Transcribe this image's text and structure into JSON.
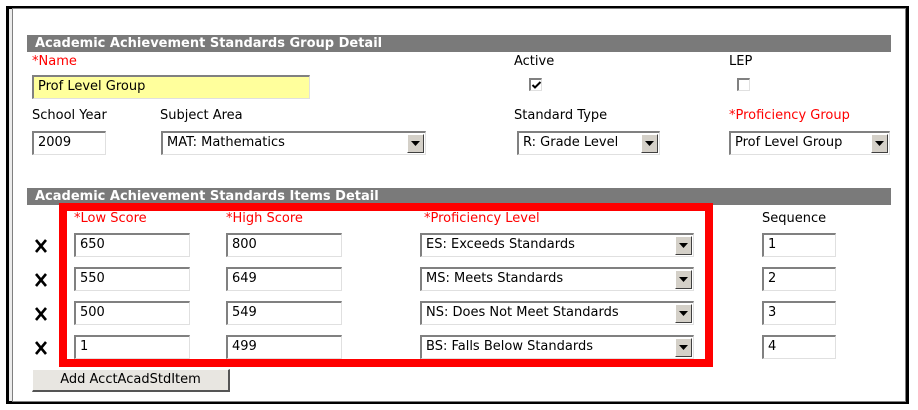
{
  "group_detail": {
    "header": "Academic Achievement Standards Group Detail",
    "name_label": "*Name",
    "name_value": "Prof Level Group",
    "active_label": "Active",
    "active_checked": true,
    "lep_label": "LEP",
    "lep_checked": false,
    "school_year_label": "School Year",
    "school_year_value": "2009",
    "subject_area_label": "Subject Area",
    "subject_area_value": "MAT: Mathematics",
    "standard_type_label": "Standard Type",
    "standard_type_value": "R: Grade Level",
    "proficiency_group_label": "*Proficiency Group",
    "proficiency_group_value": "Prof Level Group"
  },
  "items_detail": {
    "header": "Academic Achievement Standards Items Detail",
    "columns": {
      "low_score": "*Low Score",
      "high_score": "*High Score",
      "proficiency_level": "*Proficiency Level",
      "sequence": "Sequence"
    },
    "rows": [
      {
        "low": "650",
        "high": "800",
        "level": "ES: Exceeds Standards",
        "seq": "1"
      },
      {
        "low": "550",
        "high": "649",
        "level": "MS: Meets Standards",
        "seq": "2"
      },
      {
        "low": "500",
        "high": "549",
        "level": "NS: Does Not Meet Standards",
        "seq": "3"
      },
      {
        "low": "1",
        "high": "499",
        "level": "BS: Falls Below Standards",
        "seq": "4"
      }
    ],
    "add_button": "Add AcctAcadStdItem"
  },
  "colors": {
    "required": "#ff0000",
    "header_bg": "#7a7a7a",
    "highlight_box": "#ff0000",
    "name_field_bg": "#ffff9c"
  },
  "icons": {
    "delete": "delete-x-icon",
    "dropdown": "chevron-down-icon",
    "check": "checkmark-icon"
  }
}
